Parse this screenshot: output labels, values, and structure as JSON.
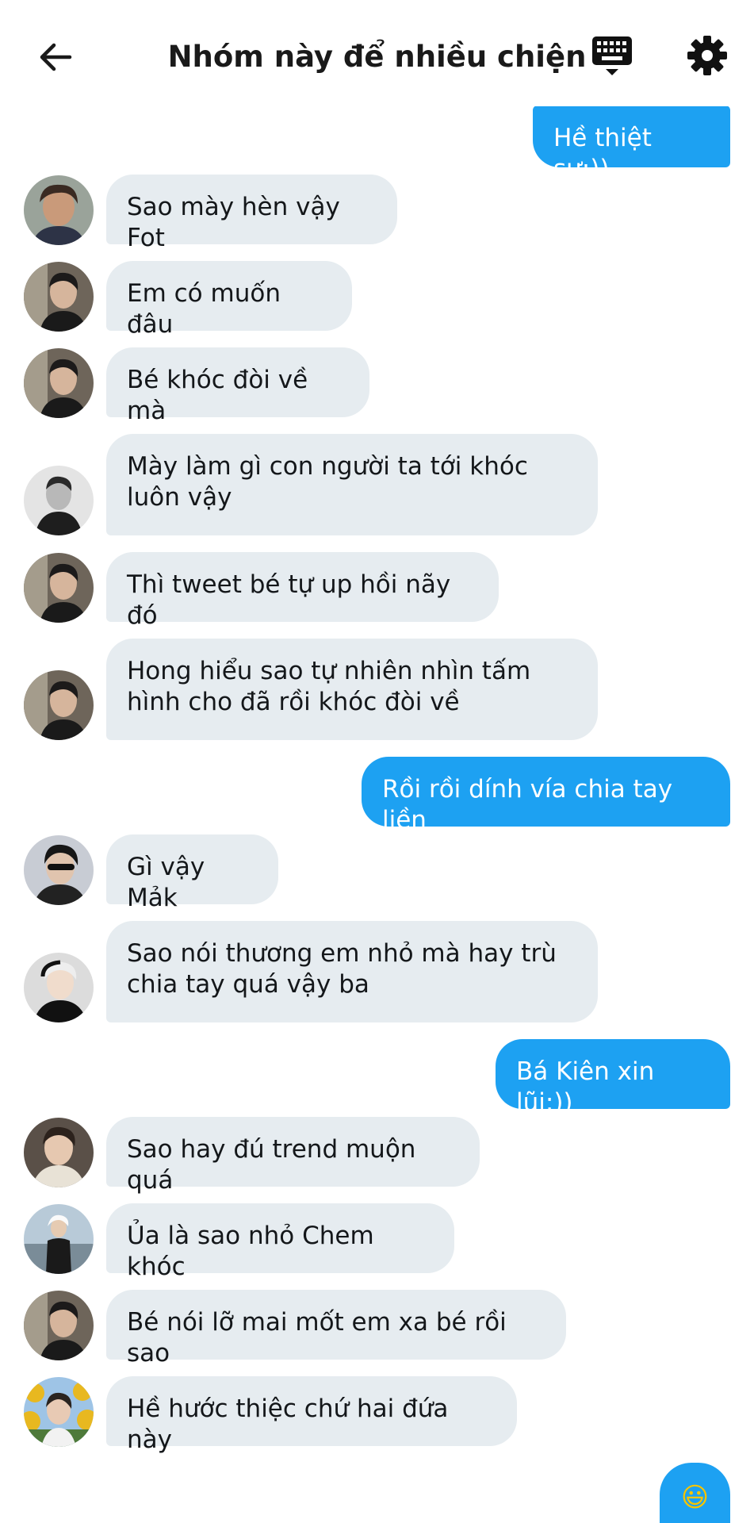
{
  "header": {
    "title": "Nhóm này để nhiều chiện",
    "icons": [
      "back-arrow-icon",
      "keyboard-icon",
      "gear-icon"
    ]
  },
  "colors": {
    "outgoing_bubble": "#1da1f2",
    "incoming_bubble": "#e6ecf0",
    "text": "#14171a"
  },
  "messages": [
    {
      "direction": "outgoing",
      "text": "Hề thiệt sự:))"
    },
    {
      "direction": "incoming",
      "avatar": "user-avatar-a",
      "text": "Sao mày hèn vậy Fot"
    },
    {
      "direction": "incoming",
      "avatar": "user-avatar-b",
      "text": "Em có muốn đâu"
    },
    {
      "direction": "incoming",
      "avatar": "user-avatar-b",
      "text": "Bé khóc đòi về mà"
    },
    {
      "direction": "incoming",
      "avatar": "user-avatar-c",
      "text": "Mày làm gì con người ta tới khóc\nluôn vậy"
    },
    {
      "direction": "incoming",
      "avatar": "user-avatar-b",
      "text": "Thì tweet bé tự up hồi nãy đó"
    },
    {
      "direction": "incoming",
      "avatar": "user-avatar-b",
      "text": "Hong hiểu sao tự nhiên nhìn tấm\nhình cho đã rồi khóc đòi về"
    },
    {
      "direction": "outgoing",
      "text": "Rồi rồi dính vía chia tay liền"
    },
    {
      "direction": "incoming",
      "avatar": "user-avatar-d",
      "text": "Gì vậy Mảk"
    },
    {
      "direction": "incoming",
      "avatar": "user-avatar-e",
      "text": "Sao nói thương em nhỏ mà hay trù\nchia tay quá vậy ba"
    },
    {
      "direction": "outgoing",
      "text": "Bá Kiên xin lũi:))"
    },
    {
      "direction": "incoming",
      "avatar": "user-avatar-f",
      "text": "Sao hay đú trend muộn quá"
    },
    {
      "direction": "incoming",
      "avatar": "user-avatar-g",
      "text": "Ủa là sao nhỏ Chem khóc"
    },
    {
      "direction": "incoming",
      "avatar": "user-avatar-b",
      "text": "Bé nói lỡ mai mốt em xa bé rồi sao"
    },
    {
      "direction": "incoming",
      "avatar": "user-avatar-h",
      "text": "Hề hước thiệc chứ hai đứa này"
    },
    {
      "direction": "outgoing",
      "text": "😃"
    }
  ]
}
